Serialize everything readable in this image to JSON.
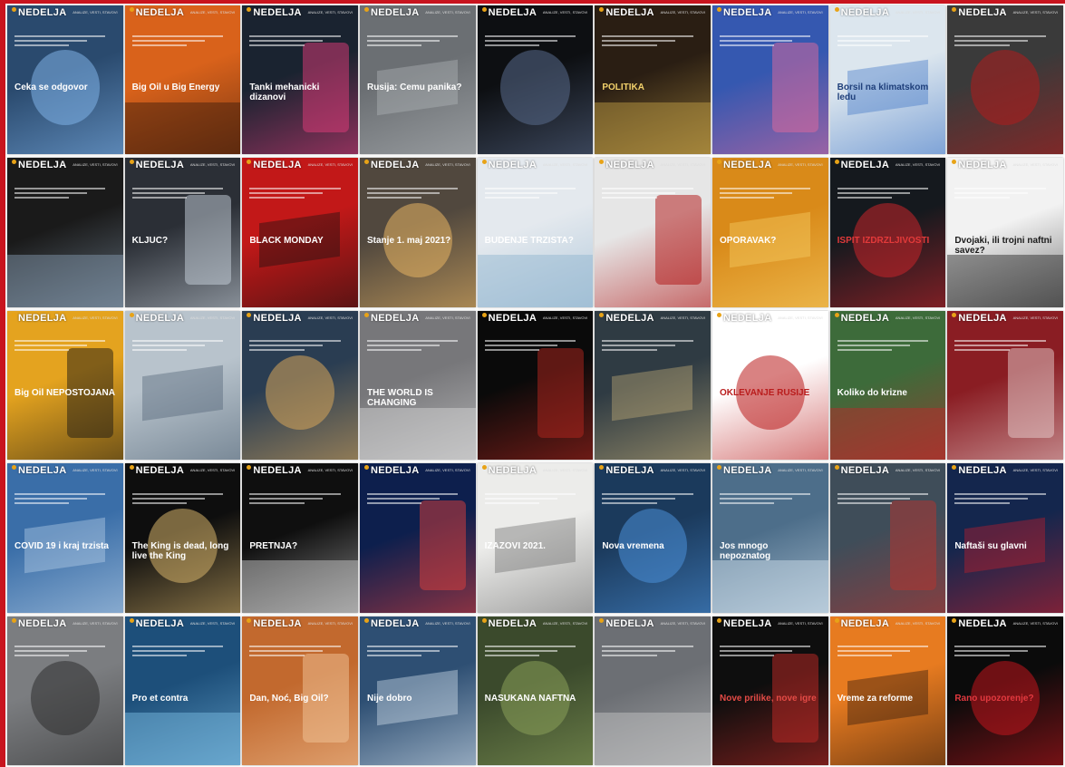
{
  "collage": {
    "brand_default": "NEDELJA",
    "subline": "ANALIZE, VESTI, STAVOVI",
    "covers": [
      {
        "headline": "Ceka se odgovor",
        "bg": "#2a4a6e",
        "accent": "#7fb2e8",
        "text": "#ffffff"
      },
      {
        "headline": "Big Oil u Big Energy",
        "bg": "#d9621b",
        "accent": "#3a1a0c",
        "text": "#ffffff"
      },
      {
        "headline": "Tanki mehanicki dizanovi",
        "bg": "#1a2330",
        "accent": "#e23b7a",
        "text": "#ffffff"
      },
      {
        "headline": "Rusija: Cemu panika?",
        "bg": "#6b6f73",
        "accent": "#b5b9bc",
        "text": "#ffffff"
      },
      {
        "headline": "",
        "bg": "#0d0f12",
        "accent": "#5a6b8c",
        "text": "#ffffff"
      },
      {
        "headline": "POLITIKA",
        "bg": "#2a1e13",
        "accent": "#c8a348",
        "text": "#f2d16b"
      },
      {
        "headline": "",
        "bg": "#3558b0",
        "accent": "#e26a9c",
        "text": "#ffffff"
      },
      {
        "headline": "Borsil na klimatskom ledu",
        "bg": "#dce6ee",
        "accent": "#3b73c6",
        "text": "#1f3f7a"
      },
      {
        "headline": "",
        "bg": "#3a3a3a",
        "accent": "#b01c1c",
        "text": "#ffffff"
      },
      {
        "headline": "",
        "bg": "#1a1a1a",
        "accent": "#8aa0b5",
        "text": "#ffffff"
      },
      {
        "headline": "KLJUC?",
        "bg": "#2b2f36",
        "accent": "#c9d3dd",
        "text": "#ffffff"
      },
      {
        "headline": "BLACK MONDAY",
        "bg": "#c21818",
        "accent": "#111111",
        "text": "#ffffff"
      },
      {
        "headline": "Stanje 1. maj 2021?",
        "bg": "#51483e",
        "accent": "#e8b563",
        "text": "#ffffff"
      },
      {
        "headline": "BUDENJE TRZISTA?",
        "bg": "#e4e9ee",
        "accent": "#8fb3cf",
        "text": "#ffffff"
      },
      {
        "headline": "",
        "bg": "#e6e6e6",
        "accent": "#b01010",
        "text": "#222222"
      },
      {
        "headline": "OPORAVAK?",
        "bg": "#d98a19",
        "accent": "#f7d26a",
        "text": "#ffffff"
      },
      {
        "headline": "ISPIT IZDRZLJIVOSTI",
        "bg": "#15191e",
        "accent": "#c9242a",
        "text": "#e33a3a"
      },
      {
        "headline": "Dvojaki, ili trojni naftni savez?",
        "bg": "#f2f2f2",
        "accent": "#222222",
        "text": "#1a1a1a"
      },
      {
        "headline": "Big Oil NEPOSTOJANA",
        "bg": "#e4a31f",
        "accent": "#1d1a14",
        "text": "#ffffff"
      },
      {
        "headline": "",
        "bg": "#b8c3cc",
        "accent": "#4d6072",
        "text": "#ffffff"
      },
      {
        "headline": "",
        "bg": "#2a3d52",
        "accent": "#d7a65a",
        "text": "#ffffff"
      },
      {
        "headline": "THE WORLD IS CHANGING",
        "bg": "#77777a",
        "accent": "#dcdcdc",
        "text": "#ffffff"
      },
      {
        "headline": "",
        "bg": "#0a0a0a",
        "accent": "#b3261e",
        "text": "#ffffff"
      },
      {
        "headline": "",
        "bg": "#2f3b43",
        "accent": "#c8b27a",
        "text": "#ffffff"
      },
      {
        "headline": "OKLEVANJE RUSIJE",
        "bg": "#ffffff",
        "accent": "#b91c1c",
        "text": "#b91c1c"
      },
      {
        "headline": "Koliko do krizne",
        "bg": "#3d6b3a",
        "accent": "#c4262b",
        "text": "#ffffff"
      },
      {
        "headline": "",
        "bg": "#8a1d23",
        "accent": "#e8d0d0",
        "text": "#ffffff"
      },
      {
        "headline": "COVID 19 i kraj trzista",
        "bg": "#3a6ea8",
        "accent": "#bfd5ea",
        "text": "#ffffff"
      },
      {
        "headline": "The King is dead, long live the King",
        "bg": "#0e0e0e",
        "accent": "#d6b36a",
        "text": "#ffffff"
      },
      {
        "headline": "PRETNJA?",
        "bg": "#0f0f0f",
        "accent": "#d8d8d8",
        "text": "#ffffff"
      },
      {
        "headline": "",
        "bg": "#0d1f4d",
        "accent": "#e0403c",
        "text": "#ffffff"
      },
      {
        "headline": "IZAZOVI 2021.",
        "bg": "#ececea",
        "accent": "#6a6a6a",
        "text": "#ffffff"
      },
      {
        "headline": "Nova vremena",
        "bg": "#1b3a5c",
        "accent": "#4a90d9",
        "text": "#ffffff"
      },
      {
        "headline": "Jos mnogo nepoznatog",
        "bg": "#4d6e8a",
        "accent": "#d7e6f2",
        "text": "#ffffff"
      },
      {
        "headline": "",
        "bg": "#3f4d59",
        "accent": "#b7332e",
        "text": "#ffffff"
      },
      {
        "headline": "Naftaši su glavni",
        "bg": "#14264d",
        "accent": "#c81f2a",
        "text": "#ffffff"
      },
      {
        "headline": "",
        "bg": "#7b7d80",
        "accent": "#2d2d2d",
        "text": "#ffffff"
      },
      {
        "headline": "Pro et contra",
        "bg": "#1d4f7a",
        "accent": "#7fc0e6",
        "text": "#ffffff"
      },
      {
        "headline": "Dan, Noć, Big Oil?",
        "bg": "#c2692e",
        "accent": "#f2c59a",
        "text": "#ffffff"
      },
      {
        "headline": "Nije dobro",
        "bg": "#2e4f73",
        "accent": "#dce8f2",
        "text": "#ffffff"
      },
      {
        "headline": "NASUKANA NAFTNA",
        "bg": "#3b4a2c",
        "accent": "#8aa05a",
        "text": "#ffffff"
      },
      {
        "headline": "",
        "bg": "#6c6f74",
        "accent": "#c9c9c9",
        "text": "#ffffff"
      },
      {
        "headline": "Nove prilike, nove igre",
        "bg": "#0e0e0e",
        "accent": "#c42a26",
        "text": "#e44b46"
      },
      {
        "headline": "Vreme za reforme",
        "bg": "#e77b20",
        "accent": "#2a170c",
        "text": "#ffffff"
      },
      {
        "headline": "Rano upozorenje?",
        "bg": "#0b0b0b",
        "accent": "#c2161d",
        "text": "#e2393f"
      }
    ]
  }
}
